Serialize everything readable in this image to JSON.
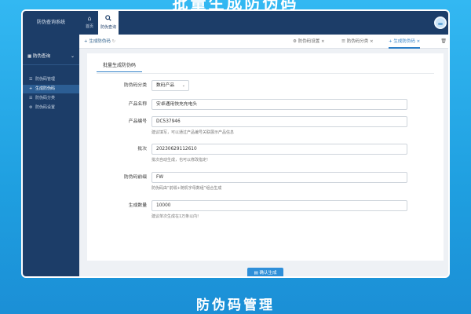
{
  "page": {
    "top_title": "批量生成防伪码",
    "bottom_title": "防伪码管理"
  },
  "topbar": {
    "brand": "防伪查询系统",
    "nav": [
      {
        "icon": "home-icon",
        "label": "首页"
      },
      {
        "icon": "search-icon",
        "label": "防伪查询"
      }
    ]
  },
  "sidebar": {
    "group_label": "防伪查询",
    "items": [
      {
        "icon": "list-icon",
        "label": "防伪码管理",
        "active": false
      },
      {
        "icon": "plus-icon",
        "label": "生成防伪码",
        "active": true
      },
      {
        "icon": "list-icon",
        "label": "防伪码分类",
        "active": false
      },
      {
        "icon": "gear-icon",
        "label": "防伪码设置",
        "active": false
      }
    ]
  },
  "tabbar": {
    "left_tab": "生成防伪码",
    "tabs": [
      {
        "icon": "gear-icon",
        "label": "防伪码设置"
      },
      {
        "icon": "list-icon",
        "label": "防伪码分类"
      },
      {
        "icon": "plus-icon",
        "label": "生成防伪码"
      }
    ]
  },
  "form": {
    "tab_label": "批量生成防伪码",
    "category": {
      "label": "防伪码分类",
      "value": "数码产品"
    },
    "product_name": {
      "label": "产品名称",
      "value": "安卓通用快充充电头"
    },
    "product_code": {
      "label": "产品编号",
      "value": "DC537946",
      "help": "建议填写，可以通过产品编号关联展示产品信息"
    },
    "batch": {
      "label": "批次",
      "value": "20230629112610",
      "help": "批次自动生成，也可以修改指定!"
    },
    "prefix": {
      "label": "防伪码前缀",
      "value": "FW",
      "help": "防伪码由“前缀+随机字母数组”组合生成"
    },
    "quantity": {
      "label": "生成数量",
      "value": "10000",
      "help": "建议单次生成在1万条以内!"
    },
    "confirm_label": "确认生成"
  },
  "colors": {
    "topbar": "#1c3d68",
    "accent": "#2e7fc7",
    "button": "#2e8fd9",
    "background": "#1f9fe0"
  }
}
